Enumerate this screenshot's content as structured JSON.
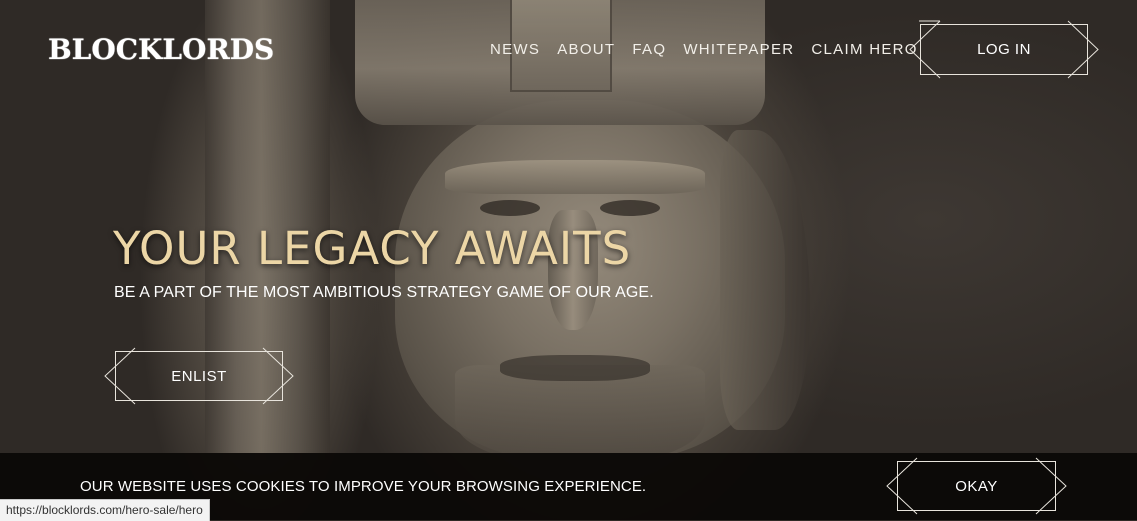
{
  "header": {
    "logo": "BLOCKLORDS",
    "nav": [
      {
        "label": "NEWS"
      },
      {
        "label": "ABOUT"
      },
      {
        "label": "FAQ"
      },
      {
        "label": "WHITEPAPER"
      },
      {
        "label": "CLAIM HERO"
      }
    ],
    "login_label": "LOG IN"
  },
  "hero": {
    "title": "YOUR LEGACY AWAITS",
    "subtitle": "BE A PART OF THE MOST AMBITIOUS STRATEGY GAME OF OUR AGE.",
    "cta_label": "ENLIST"
  },
  "cookie_banner": {
    "message": "OUR WEBSITE USES COOKIES TO IMPROVE YOUR BROWSING EXPERIENCE.",
    "okay_label": "OKAY"
  },
  "status_bar": {
    "url": "https://blocklords.com/hero-sale/hero"
  },
  "colors": {
    "title": "#ecd6a6",
    "background": "#2e2925",
    "cookie_bg": "#0b0907"
  }
}
